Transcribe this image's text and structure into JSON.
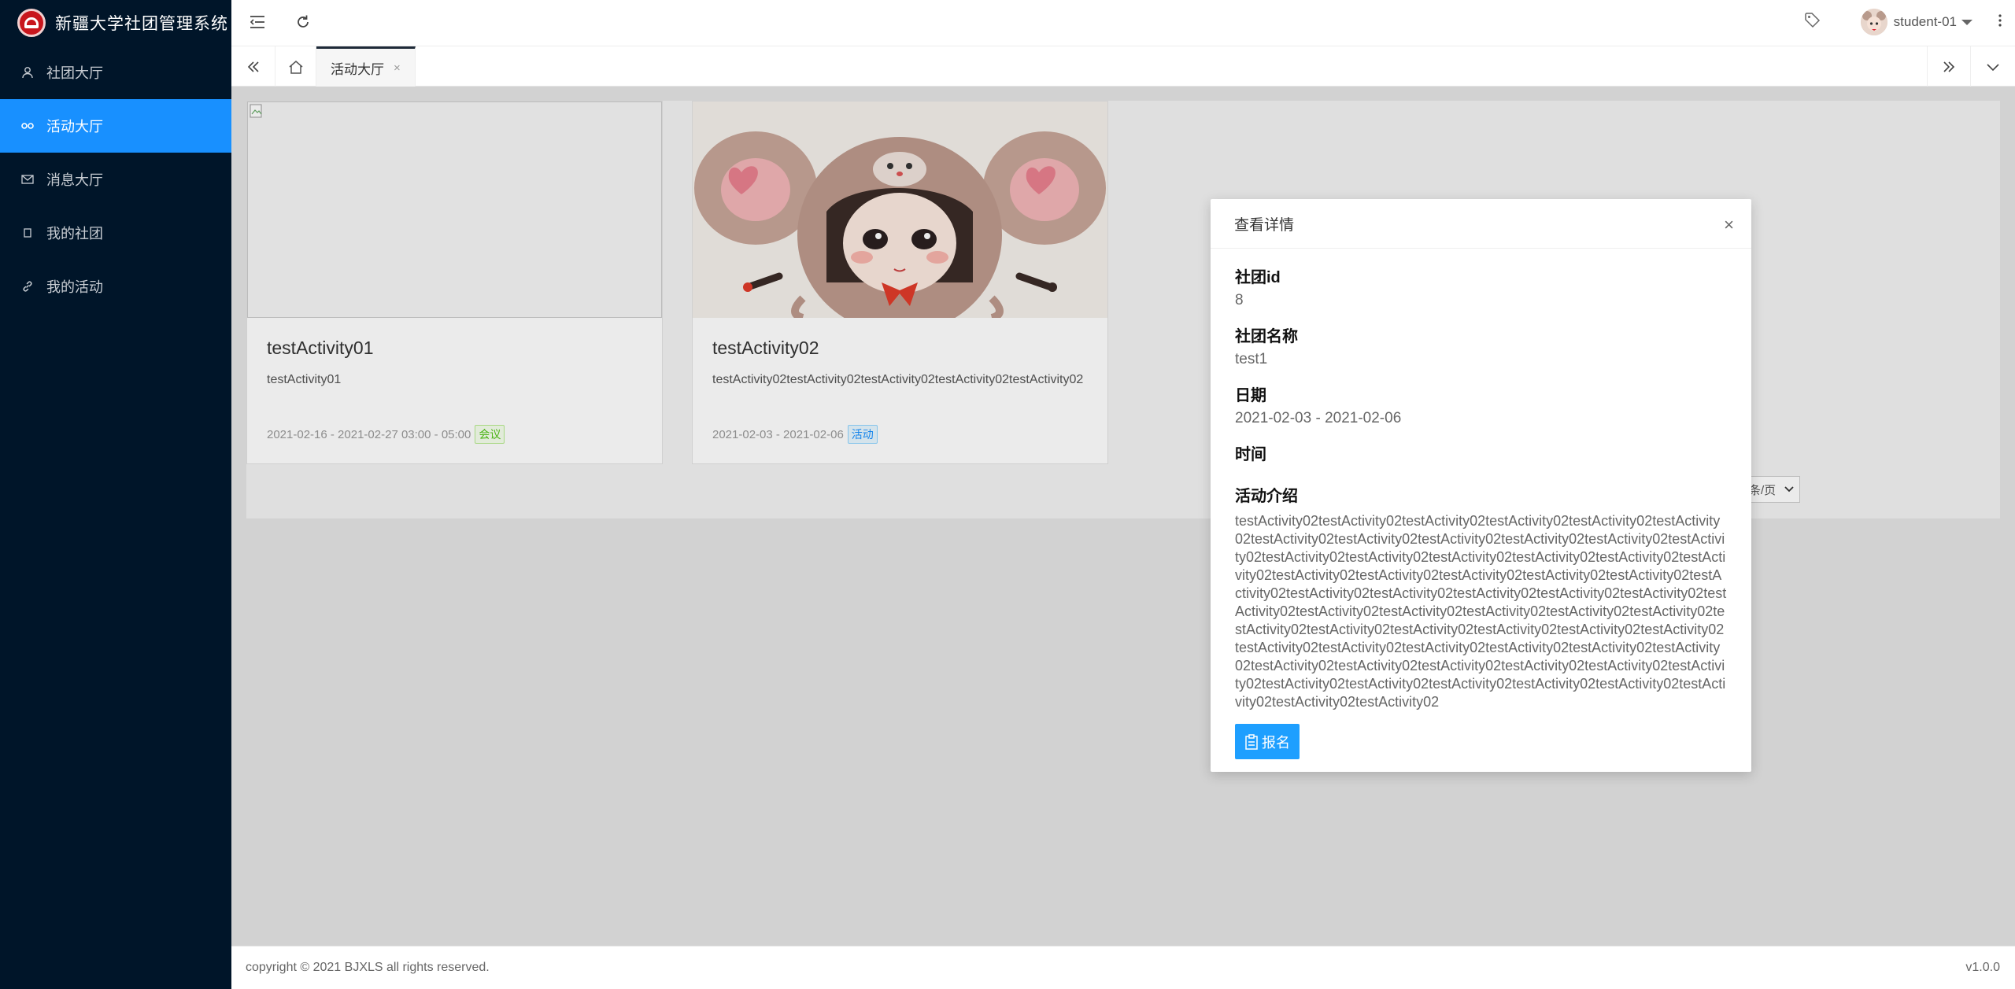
{
  "app": {
    "title": "新疆大学社团管理系统"
  },
  "sidebar": {
    "items": [
      {
        "label": "社团大厅",
        "icon": "user-icon",
        "active": false
      },
      {
        "label": "活动大厅",
        "icon": "link-icon",
        "active": true
      },
      {
        "label": "消息大厅",
        "icon": "mail-icon",
        "active": false
      },
      {
        "label": "我的社团",
        "icon": "square-icon",
        "active": false
      },
      {
        "label": "我的活动",
        "icon": "chain-icon",
        "active": false
      }
    ]
  },
  "header": {
    "username": "student-01"
  },
  "tabs": {
    "active_label": "活动大厅",
    "close_symbol": "×"
  },
  "cards": [
    {
      "title": "testActivity01",
      "desc": "testActivity01",
      "date": "2021-02-16 - 2021-02-27 03:00 - 05:00",
      "tag": "会议"
    },
    {
      "title": "testActivity02",
      "desc": "testActivity02testActivity02testActivity02testActivity02testActivity02",
      "date": "2021-02-03 - 2021-02-06",
      "tag": "活动"
    }
  ],
  "pager": {
    "per_page_suffix": "条/页"
  },
  "modal": {
    "title": "查看详情",
    "close": "×",
    "club_id_label": "社团id",
    "club_id": "8",
    "club_name_label": "社团名称",
    "club_name": "test1",
    "date_label": "日期",
    "date": "2021-02-03 - 2021-02-06",
    "time_label": "时间",
    "intro_label": "活动介绍",
    "intro": "testActivity02testActivity02testActivity02testActivity02testActivity02testActivity02testActivity02testActivity02testActivity02testActivity02testActivity02testActivity02testActivity02testActivity02testActivity02testActivity02testActivity02testActivity02testActivity02testActivity02testActivity02testActivity02testActivity02testActivity02testActivity02testActivity02testActivity02testActivity02testActivity02testActivity02testActivity02testActivity02testActivity02testActivity02testActivity02testActivity02testActivity02testActivity02testActivity02testActivity02testActivity02testActivity02testActivity02testActivity02testActivity02testActivity02testActivity02testActivity02testActivity02testActivity02testActivity02testActivity02testActivity02testActivity02testActivity02testActivity02testActivity02testActivity02testActivity02testActivity02testActivity02",
    "signup_label": "报名"
  },
  "footer": {
    "copyright": "copyright © 2021 BJXLS all rights reserved.",
    "version": "v1.0.0"
  },
  "colors": {
    "sidebar_bg": "#001529",
    "accent": "#1890ff",
    "signup_button": "#1e9fff"
  }
}
